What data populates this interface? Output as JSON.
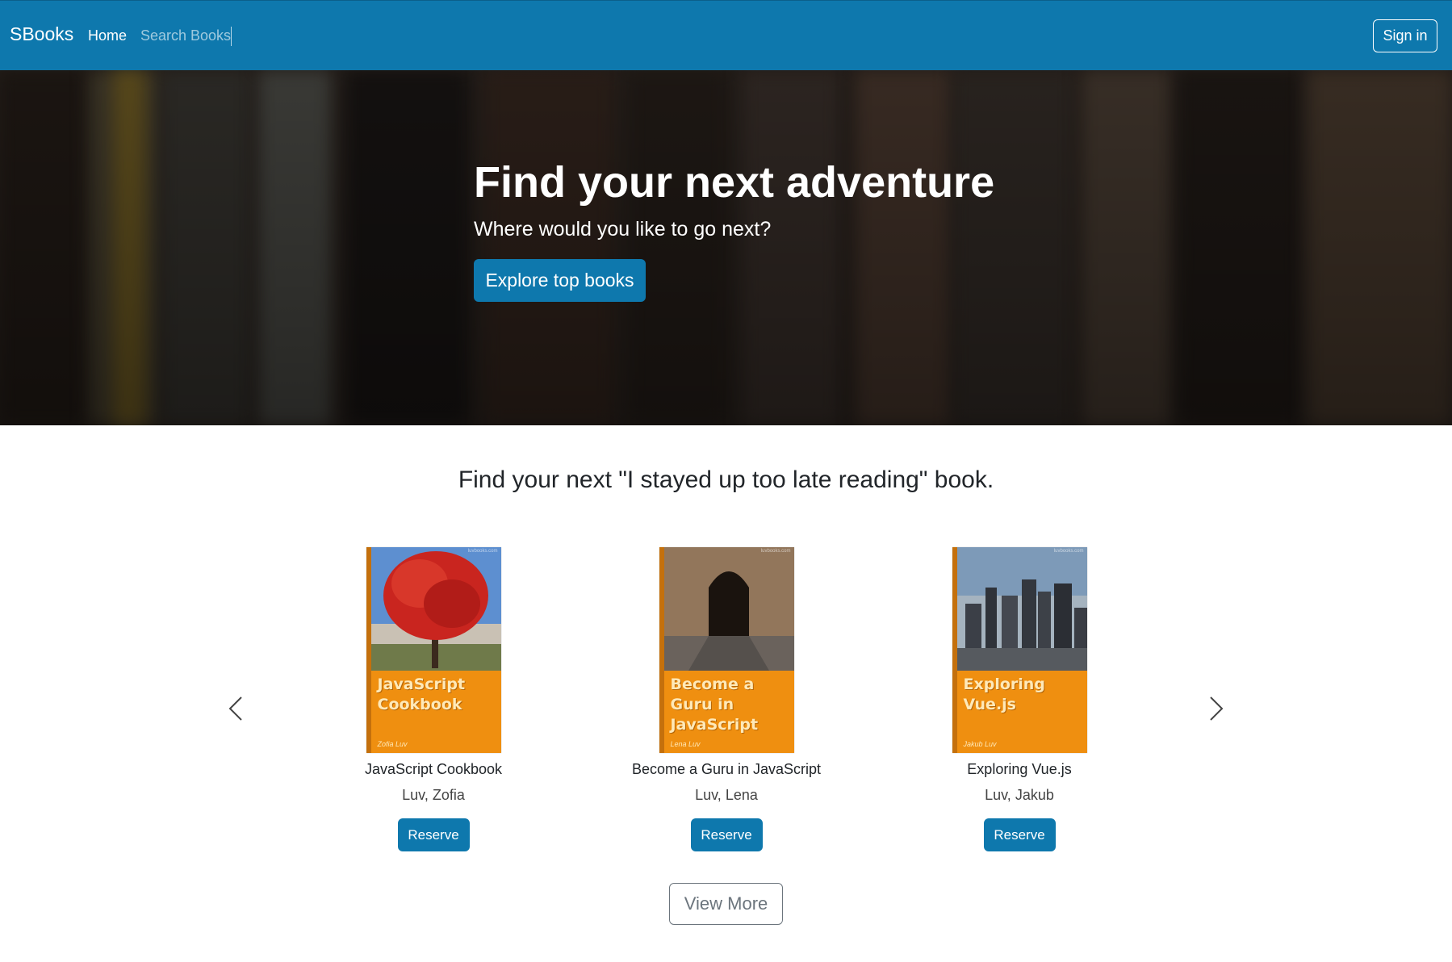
{
  "navbar": {
    "brand": "SBooks",
    "home_label": "Home",
    "search_label": "Search Books",
    "signin_label": "Sign in"
  },
  "hero": {
    "title": "Find your next adventure",
    "subtitle": "Where would you like to go next?",
    "button_label": "Explore top books"
  },
  "section": {
    "heading": "Find your next \"I stayed up too late reading\" book."
  },
  "carousel": {
    "prev_icon": "chevron-left-icon",
    "next_icon": "chevron-right-icon",
    "books": [
      {
        "title": "JavaScript Cookbook",
        "author": "Luv, Zofia",
        "cover_title": "JavaScript Cookbook",
        "cover_author": "Zofia Luv",
        "reserve_label": "Reserve"
      },
      {
        "title": "Become a Guru in JavaScript",
        "author": "Luv, Lena",
        "cover_title": "Become a Guru in JavaScript",
        "cover_author": "Lena Luv",
        "reserve_label": "Reserve"
      },
      {
        "title": "Exploring Vue.js",
        "author": "Luv, Jakub",
        "cover_title": "Exploring Vue.js",
        "cover_author": "Jakub Luv",
        "reserve_label": "Reserve"
      }
    ]
  },
  "view_more_label": "View More",
  "colors": {
    "primary": "#0e78ad",
    "cover_orange": "#ef8f10",
    "secondary": "#6c757d"
  }
}
